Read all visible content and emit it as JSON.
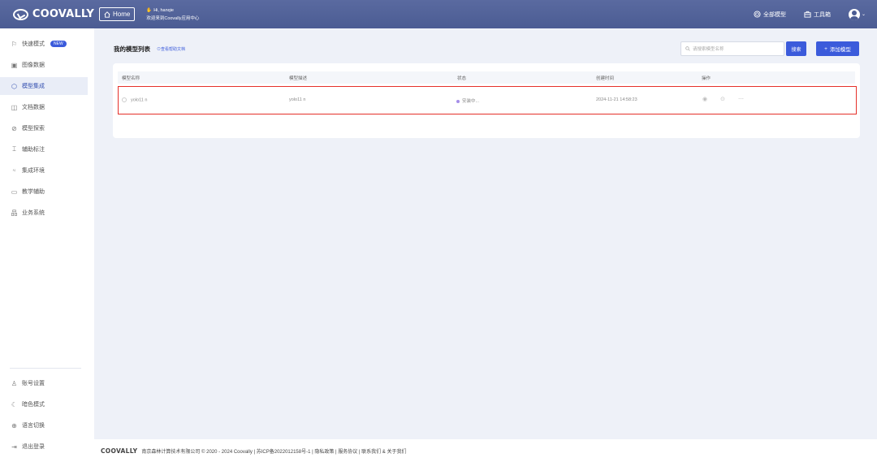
{
  "header": {
    "logo_text": "COOVALLY",
    "home_label": "Home",
    "greeting": "Hi, hanqie",
    "welcome": "欢迎来到Coovally应用中心",
    "all_models": "全部模型",
    "toolbox": "工具箱"
  },
  "sidebar": {
    "items": [
      {
        "label": "快速模式",
        "badge": "NEW"
      },
      {
        "label": "图像数据"
      },
      {
        "label": "模型集成"
      },
      {
        "label": "文档数据"
      },
      {
        "label": "模型探索"
      },
      {
        "label": "辅助标注"
      },
      {
        "label": "集成环境"
      },
      {
        "label": "教学辅助"
      },
      {
        "label": "业务系统"
      }
    ],
    "bottom": [
      {
        "label": "账号设置"
      },
      {
        "label": "暗色模式"
      },
      {
        "label": "语言切换"
      },
      {
        "label": "退出登录"
      }
    ]
  },
  "main": {
    "list_title": "我的模型列表",
    "help_link": "⊙查看帮助文档",
    "search_placeholder": "请搜索模型名称",
    "search_button": "搜索",
    "add_button": "添加模型",
    "columns": [
      "模型名称",
      "模型描述",
      "状态",
      "创建时间",
      "操作"
    ],
    "rows": [
      {
        "name": "yolo11 n",
        "description": "yolo11 n",
        "status": "安装中...",
        "created": "2024-11-21 14:58:23"
      }
    ]
  },
  "footer": {
    "logo": "COOVALLY",
    "text": "南京森林计算技术有限公司 © 2020 - 2024 Coovally | 苏ICP备2022012158号-1 | 隐私政策 | 服务协议 | 联系我们 & 关于我们"
  }
}
